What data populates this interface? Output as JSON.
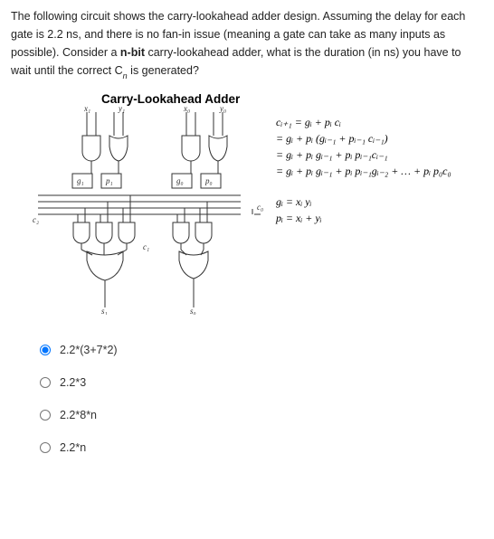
{
  "question": {
    "p1a": "The following circuit shows the carry-lookahead adder design.  Assuming the delay for each gate is 2.2 ns, and there is no fan-in issue (meaning a gate can take as many inputs as possible). Consider a ",
    "p1b": "n-bit",
    "p1c": " carry-lookahead adder, what is the duration (in ns) you have to wait until the correct C",
    "p1d": " is generated?",
    "subn": "n"
  },
  "figure": {
    "title": "Carry-Lookahead Adder",
    "eq1_l1": "cᵢ₊₁ = gᵢ + pᵢ cᵢ",
    "eq1_l2": "= gᵢ + pᵢ (gᵢ₋₁ + pᵢ₋₁ cᵢ₋₁)",
    "eq1_l3": "= gᵢ + pᵢ gᵢ₋₁  +  pᵢ pᵢ₋₁cᵢ₋₁",
    "eq1_l4": "= gᵢ + pᵢ gᵢ₋₁  +  pᵢ pᵢ₋₁gᵢ₋₂ + … + pᵢ p₀c₀",
    "eq2_l1": "gᵢ = xᵢ yᵢ",
    "eq2_l2": "pᵢ = xᵢ + yᵢ",
    "labels": {
      "x1": "x₁",
      "y1": "y₁",
      "x0": "x₀",
      "y0": "y₀",
      "g1": "g₁",
      "p1": "p₁",
      "g0": "g₀",
      "p0": "p₀",
      "c1": "c₁",
      "c2": "c₂",
      "c0": "c₀",
      "s1": "s₁",
      "s0": "s₀"
    }
  },
  "options": {
    "a": "2.2*(3+7*2)",
    "b": "2.2*3",
    "c": "2.2*8*n",
    "d": "2.2*n"
  },
  "chart_data": {
    "type": "diagram",
    "description": "Carry-lookahead adder circuit with generate/propagate gates feeding carry logic for two bit slices",
    "gate_delay_ns": 2.2
  }
}
